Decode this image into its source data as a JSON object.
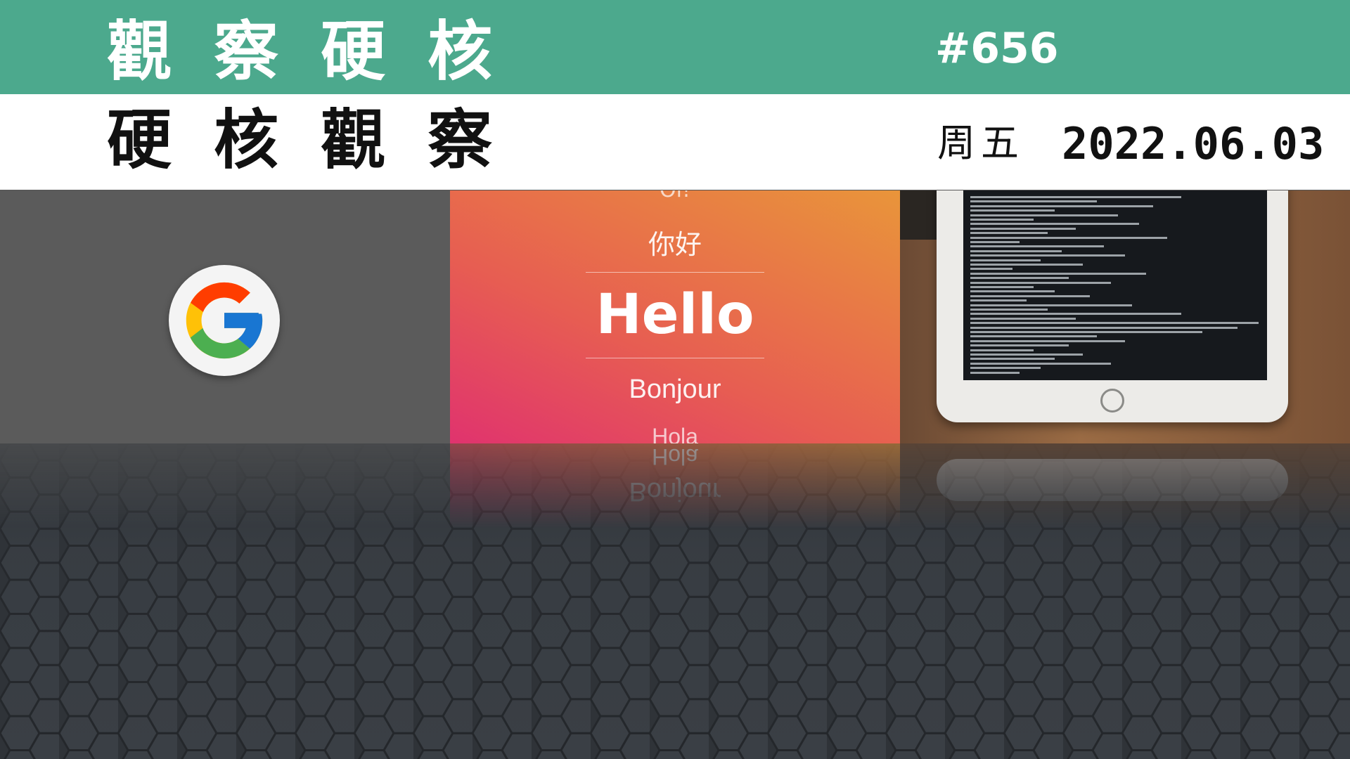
{
  "header": {
    "title_top": "觀察硬核",
    "issue_number": "#656",
    "title_bottom": "硬核觀察",
    "weekday": "周五",
    "date": "2022.06.03"
  },
  "panels": {
    "google": {
      "icon": "google-g-logo-icon"
    },
    "greetings": {
      "items": [
        "Oi!",
        "你好",
        "Hello",
        "Bonjour",
        "Hola"
      ],
      "selected": "Hello"
    },
    "tablet": {
      "icon": "tablet-terminal-photo"
    }
  },
  "colors": {
    "header_green": "#4ca98d",
    "header_white": "#ffffff",
    "panel_gray": "#5b5b5b",
    "gradient_pink": "#e0336e",
    "gradient_orange": "#e9953a",
    "floor_dark": "#2f3338"
  }
}
